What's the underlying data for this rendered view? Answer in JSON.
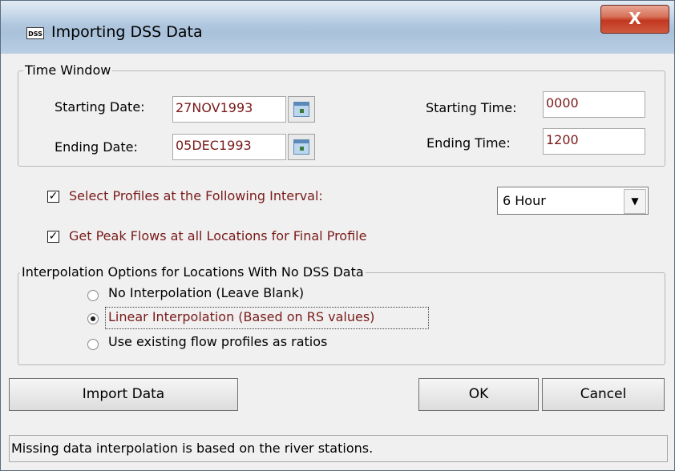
{
  "window": {
    "icon_text": "DSS",
    "title": "Importing DSS Data",
    "close_glyph": "X"
  },
  "time_window": {
    "legend": "Time Window",
    "starting_date_label": "Starting Date:",
    "starting_date_value": "27NOV1993",
    "ending_date_label": "Ending Date:",
    "ending_date_value": "05DEC1993",
    "starting_time_label": "Starting Time:",
    "starting_time_value": "0000",
    "ending_time_label": "Ending Time:",
    "ending_time_value": "1200",
    "calendar_icon": "calendar-icon"
  },
  "options": {
    "select_profiles_label": "Select Profiles at the Following Interval:",
    "select_profiles_checked": true,
    "interval_value": "6 Hour",
    "peak_flows_label": "Get Peak Flows at all Locations for Final Profile",
    "peak_flows_checked": true
  },
  "interpolation": {
    "legend": "Interpolation Options for Locations With No DSS Data",
    "choices": [
      {
        "label": "No Interpolation (Leave Blank)",
        "selected": false
      },
      {
        "label": "Linear Interpolation (Based on RS values)",
        "selected": true
      },
      {
        "label": "Use existing flow profiles as ratios",
        "selected": false
      }
    ]
  },
  "buttons": {
    "import_label": "Import Data",
    "ok_label": "OK",
    "cancel_label": "Cancel"
  },
  "status_text": "Missing data interpolation is based on the river stations.",
  "colors": {
    "accent_text": "#7a1a1a",
    "close_button": "#c2371f"
  }
}
